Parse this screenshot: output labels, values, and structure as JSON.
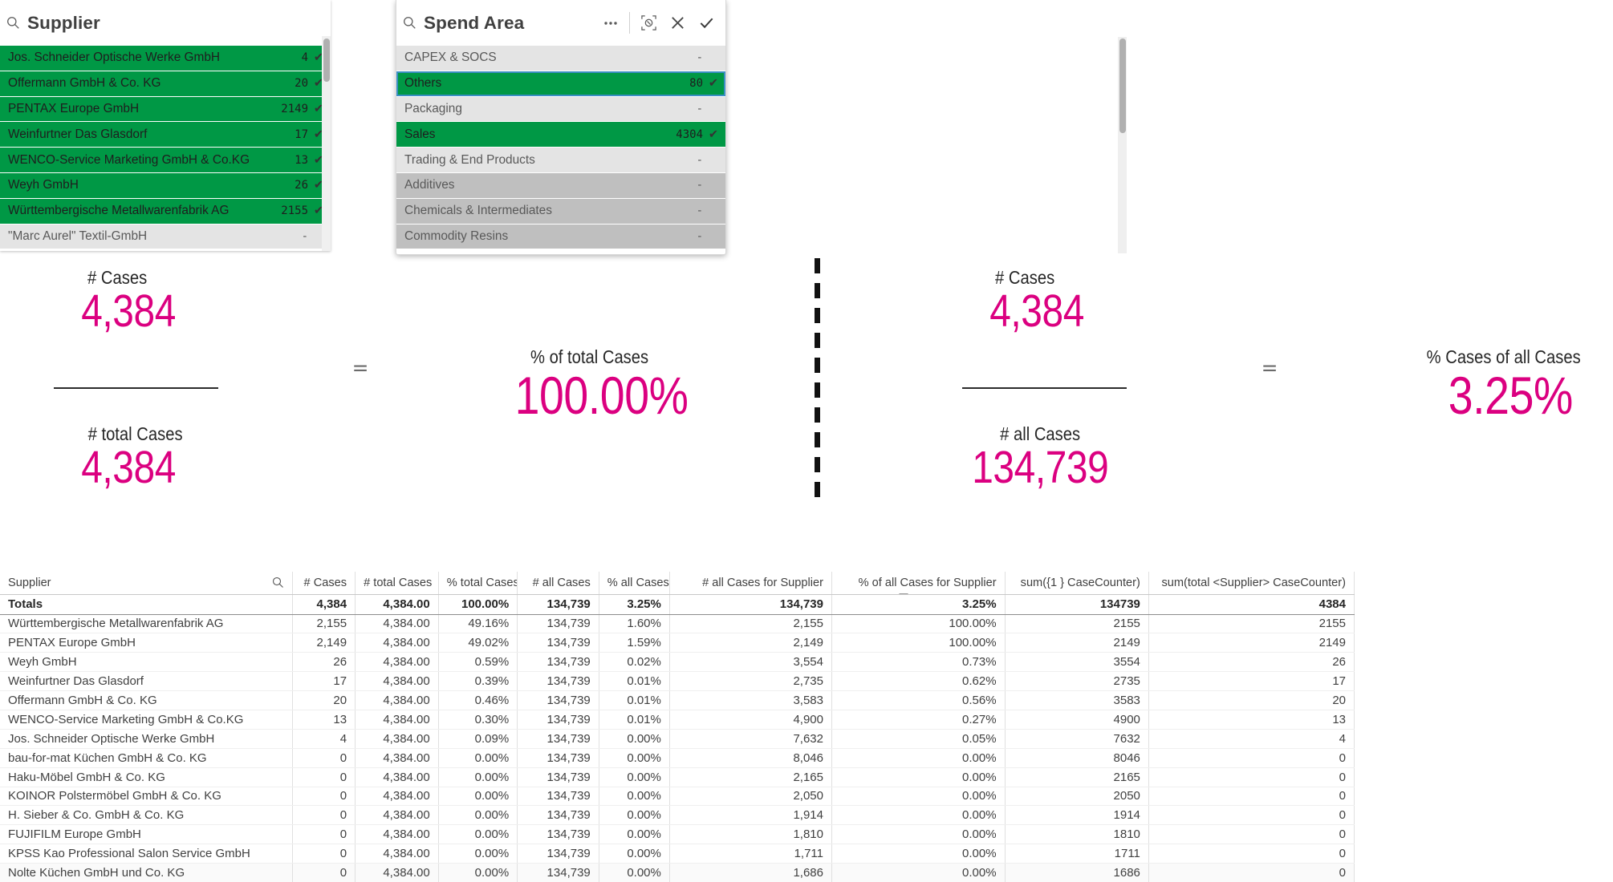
{
  "supplier_pane": {
    "title": "Supplier",
    "search_icon": "search-icon",
    "rows": [
      {
        "label": "Jos. Schneider Optische Werke GmbH",
        "value": "4",
        "state": "selected"
      },
      {
        "label": "Offermann GmbH & Co. KG",
        "value": "20",
        "state": "selected"
      },
      {
        "label": "PENTAX Europe GmbH",
        "value": "2149",
        "state": "selected"
      },
      {
        "label": "Weinfurtner Das Glasdorf",
        "value": "17",
        "state": "selected"
      },
      {
        "label": "WENCO-Service Marketing GmbH & Co.KG",
        "value": "13",
        "state": "selected"
      },
      {
        "label": "Weyh GmbH",
        "value": "26",
        "state": "selected"
      },
      {
        "label": "Württembergische Metallwarenfabrik AG",
        "value": "2155",
        "state": "selected"
      },
      {
        "label": "\"Marc Aurel\" Textil-GmbH",
        "value": "-",
        "state": "alt"
      }
    ]
  },
  "spendarea_pane": {
    "title": "Spend Area",
    "search_icon": "search-icon",
    "tools": [
      {
        "name": "more-options-icon",
        "glyph": "⋯"
      },
      {
        "name": "clear-selection-icon",
        "glyph": ""
      },
      {
        "name": "cancel-icon",
        "glyph": "✕"
      },
      {
        "name": "confirm-icon",
        "glyph": "✔"
      }
    ],
    "rows": [
      {
        "label": "CAPEX & SOCS",
        "value": "-",
        "state": "alt"
      },
      {
        "label": "Others",
        "value": "80",
        "state": "selected"
      },
      {
        "label": "Packaging",
        "value": "-",
        "state": "alt"
      },
      {
        "label": "Sales",
        "value": "4304",
        "state": "selected"
      },
      {
        "label": "Trading & End Products",
        "value": "-",
        "state": "alt"
      },
      {
        "label": "Additives",
        "value": "-",
        "state": "excl"
      },
      {
        "label": "Chemicals & Intermediates",
        "value": "-",
        "state": "excl"
      },
      {
        "label": "Commodity Resins",
        "value": "-",
        "state": "excl"
      }
    ]
  },
  "kpi": {
    "left": {
      "numerator_label": "# Cases",
      "numerator_value": "4,384",
      "denominator_label": "# total Cases",
      "denominator_value": "4,384",
      "equals": "=",
      "result_label": "% of total Cases",
      "result_value": "100.00%"
    },
    "right": {
      "numerator_label": "# Cases",
      "numerator_value": "4,384",
      "denominator_label": "# all Cases",
      "denominator_value": "134,739",
      "equals": "=",
      "result_label": "% Cases of all Cases",
      "result_value": "3.25%"
    }
  },
  "table": {
    "search_icon": "search-icon",
    "columns": [
      "Supplier",
      "# Cases",
      "# total Cases",
      "% total Cases",
      "# all Cases",
      "% all Cases",
      "# all Cases for Supplier",
      "% of all Cases for Supplier",
      "sum({1 } CaseCounter)",
      "sum(total <Supplier> CaseCounter)"
    ],
    "sorted_column_index": 7,
    "totals": [
      "Totals",
      "4,384",
      "4,384.00",
      "100.00%",
      "134,739",
      "3.25%",
      "134,739",
      "3.25%",
      "134739",
      "4384"
    ],
    "rows": [
      [
        "Württembergische Metallwarenfabrik AG",
        "2,155",
        "4,384.00",
        "49.16%",
        "134,739",
        "1.60%",
        "2,155",
        "100.00%",
        "2155",
        "2155"
      ],
      [
        "PENTAX Europe GmbH",
        "2,149",
        "4,384.00",
        "49.02%",
        "134,739",
        "1.59%",
        "2,149",
        "100.00%",
        "2149",
        "2149"
      ],
      [
        "Weyh GmbH",
        "26",
        "4,384.00",
        "0.59%",
        "134,739",
        "0.02%",
        "3,554",
        "0.73%",
        "3554",
        "26"
      ],
      [
        "Weinfurtner Das Glasdorf",
        "17",
        "4,384.00",
        "0.39%",
        "134,739",
        "0.01%",
        "2,735",
        "0.62%",
        "2735",
        "17"
      ],
      [
        "Offermann GmbH & Co. KG",
        "20",
        "4,384.00",
        "0.46%",
        "134,739",
        "0.01%",
        "3,583",
        "0.56%",
        "3583",
        "20"
      ],
      [
        "WENCO-Service Marketing GmbH & Co.KG",
        "13",
        "4,384.00",
        "0.30%",
        "134,739",
        "0.01%",
        "4,900",
        "0.27%",
        "4900",
        "13"
      ],
      [
        "Jos. Schneider Optische Werke GmbH",
        "4",
        "4,384.00",
        "0.09%",
        "134,739",
        "0.00%",
        "7,632",
        "0.05%",
        "7632",
        "4"
      ],
      [
        "bau-for-mat Küchen GmbH & Co. KG",
        "0",
        "4,384.00",
        "0.00%",
        "134,739",
        "0.00%",
        "8,046",
        "0.00%",
        "8046",
        "0"
      ],
      [
        "Haku-Möbel GmbH & Co. KG",
        "0",
        "4,384.00",
        "0.00%",
        "134,739",
        "0.00%",
        "2,165",
        "0.00%",
        "2165",
        "0"
      ],
      [
        "KOINOR Polstermöbel GmbH & Co. KG",
        "0",
        "4,384.00",
        "0.00%",
        "134,739",
        "0.00%",
        "2,050",
        "0.00%",
        "2050",
        "0"
      ],
      [
        "H. Sieber & Co. GmbH & Co. KG",
        "0",
        "4,384.00",
        "0.00%",
        "134,739",
        "0.00%",
        "1,914",
        "0.00%",
        "1914",
        "0"
      ],
      [
        "FUJIFILM Europe GmbH",
        "0",
        "4,384.00",
        "0.00%",
        "134,739",
        "0.00%",
        "1,810",
        "0.00%",
        "1810",
        "0"
      ],
      [
        "KPSS Kao Professional Salon Service GmbH",
        "0",
        "4,384.00",
        "0.00%",
        "134,739",
        "0.00%",
        "1,711",
        "0.00%",
        "1711",
        "0"
      ],
      [
        "Nolte Küchen GmbH und Co. KG",
        "0",
        "4,384.00",
        "0.00%",
        "134,739",
        "0.00%",
        "1,686",
        "0.00%",
        "1686",
        "0"
      ]
    ]
  },
  "colors": {
    "selected_green": "#009845",
    "magenta": "#DB0080",
    "alt_gray": "#e4e4e4",
    "excluded_gray": "#bfbfbf",
    "focus_blue": "#3b8fc4"
  }
}
